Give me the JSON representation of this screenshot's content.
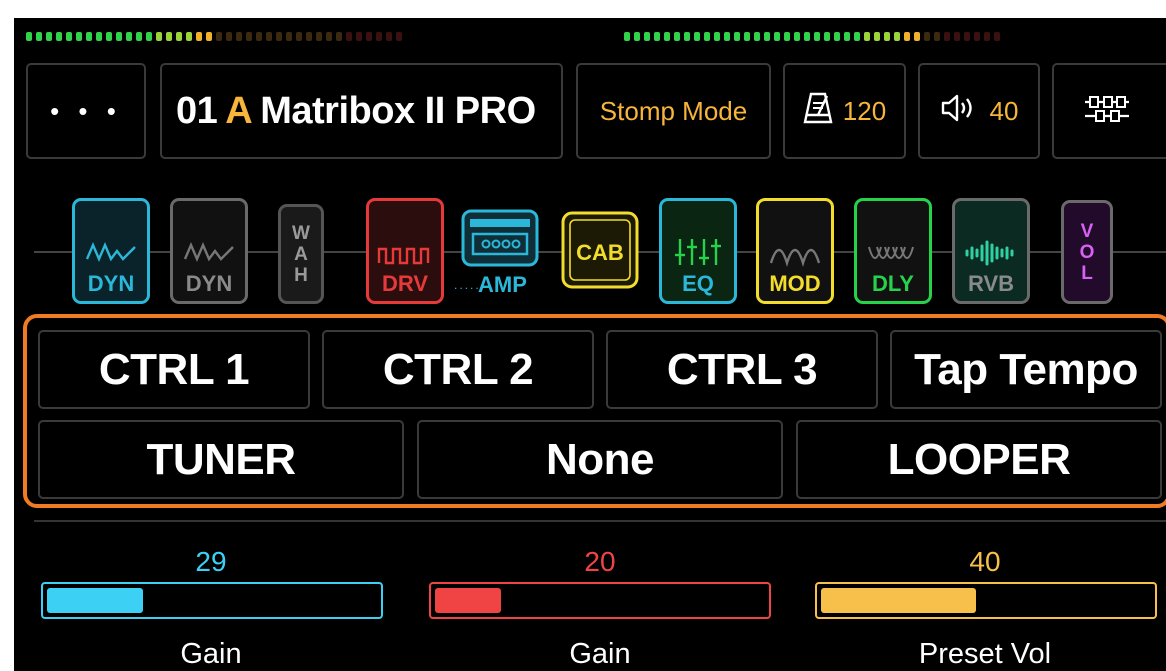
{
  "header": {
    "menu_label": "• • •",
    "preset_number": "01",
    "preset_bank": "A",
    "preset_name": "Matribox II PRO",
    "mode_label": "Stomp Mode",
    "tempo_value": "120",
    "volume_value": "40"
  },
  "chain": {
    "modules": [
      {
        "label": "DYN",
        "color": "#2bb8d8",
        "state": "on"
      },
      {
        "label": "DYN",
        "color": "#6a6a6a",
        "state": "off"
      },
      {
        "label": "W\nA\nH",
        "color": "#555555",
        "state": "off"
      },
      {
        "label": "DRV",
        "color": "#e63a3a",
        "state": "on"
      },
      {
        "label": "AMP",
        "color": "#2bb8d8",
        "state": "on"
      },
      {
        "label": "CAB",
        "color": "#f2dc2c",
        "state": "on"
      },
      {
        "label": "EQ",
        "color": "#27d24b",
        "state": "on"
      },
      {
        "label": "MOD",
        "color": "#6a6a6a",
        "state": "off"
      },
      {
        "label": "DLY",
        "color": "#6a6a6a",
        "state": "off"
      },
      {
        "label": "RVB",
        "color": "#2fd0a2",
        "state": "on"
      },
      {
        "label": "V\nO\nL",
        "color": "#b64de0",
        "state": "on"
      }
    ]
  },
  "controls": {
    "row1": [
      "CTRL 1",
      "CTRL 2",
      "CTRL 3",
      "Tap Tempo"
    ],
    "row2": [
      "TUNER",
      "None",
      "LOOPER"
    ]
  },
  "params": [
    {
      "value": "29",
      "label": "Gain",
      "color": "#3cd1f4",
      "level": 0.29
    },
    {
      "value": "20",
      "label": "Gain",
      "color": "#f04444",
      "level": 0.2
    },
    {
      "value": "40",
      "label": "Preset Vol",
      "color": "#f7c04a",
      "level": 0.47
    }
  ],
  "colors": {
    "accent": "#f7b53b",
    "frame": "#f07b22"
  },
  "icons": [
    "metronome-icon",
    "speaker-icon",
    "mixer-icon"
  ]
}
